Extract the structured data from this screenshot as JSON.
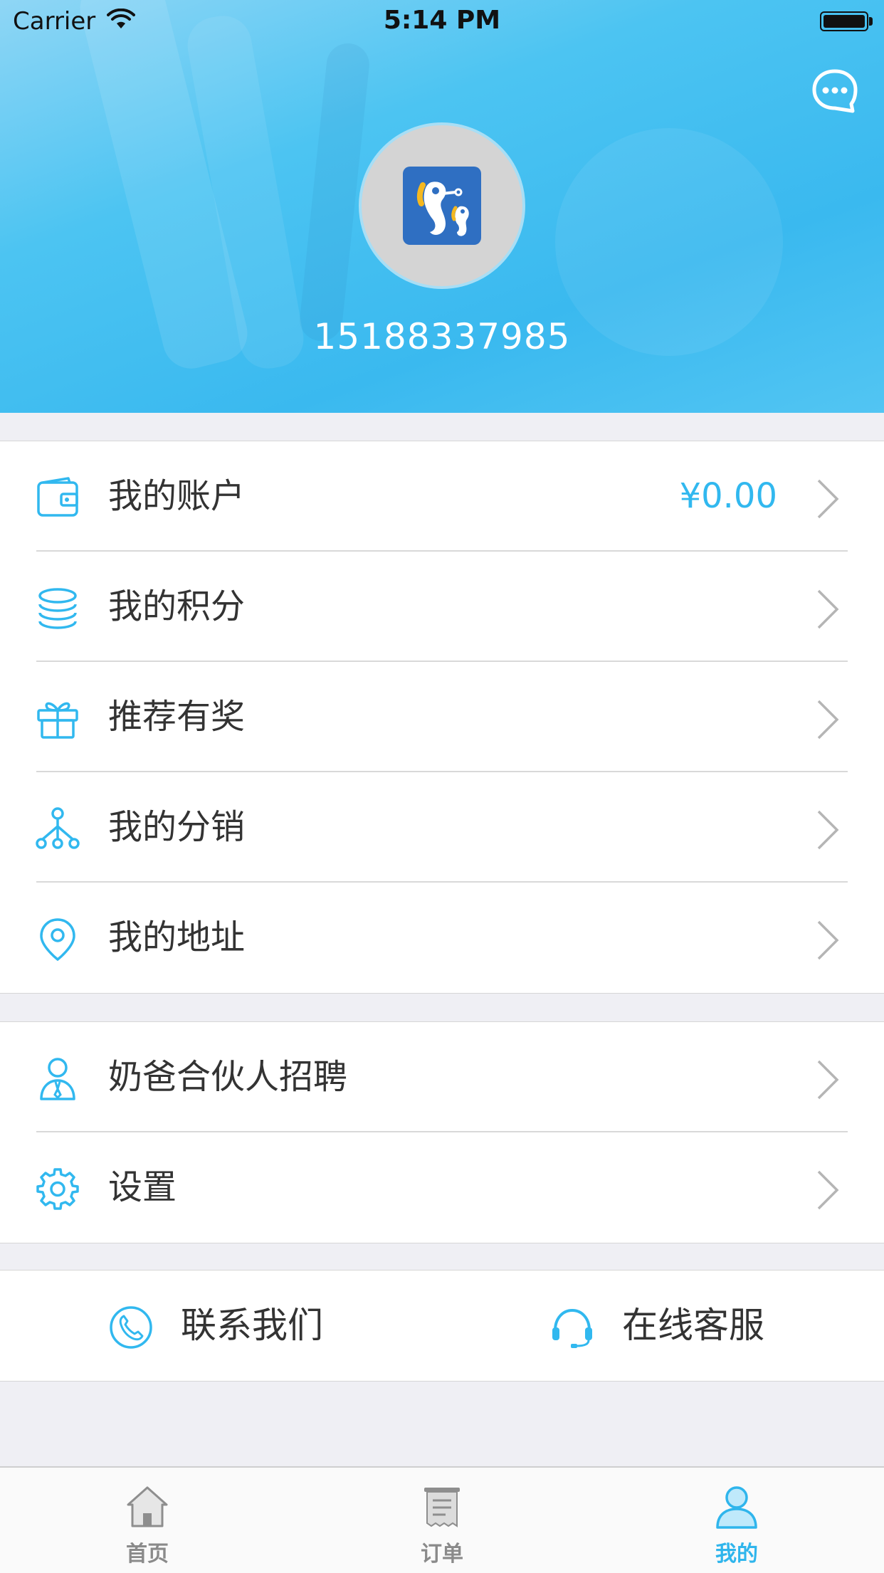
{
  "status_bar": {
    "carrier": "Carrier",
    "time": "5:14 PM"
  },
  "profile": {
    "phone": "15188337985"
  },
  "menu_group_1": {
    "items": [
      {
        "label": "我的账户",
        "value": "¥0.00",
        "icon": "wallet-icon"
      },
      {
        "label": "我的积分",
        "icon": "coins-icon"
      },
      {
        "label": "推荐有奖",
        "icon": "gift-icon"
      },
      {
        "label": "我的分销",
        "icon": "network-icon"
      },
      {
        "label": "我的地址",
        "icon": "location-pin-icon"
      }
    ]
  },
  "menu_group_2": {
    "items": [
      {
        "label": "奶爸合伙人招聘",
        "icon": "partner-icon"
      },
      {
        "label": "设置",
        "icon": "gear-icon"
      }
    ]
  },
  "contact": {
    "contact_us": "联系我们",
    "online_service": "在线客服"
  },
  "tabbar": {
    "tabs": [
      {
        "label": "首页",
        "icon": "home-icon",
        "active": false
      },
      {
        "label": "订单",
        "icon": "order-icon",
        "active": false
      },
      {
        "label": "我的",
        "icon": "profile-icon",
        "active": true
      }
    ]
  },
  "colors": {
    "accent": "#31b8ef",
    "header": "#3ab9ef",
    "background": "#efeff4",
    "text": "#333333"
  }
}
